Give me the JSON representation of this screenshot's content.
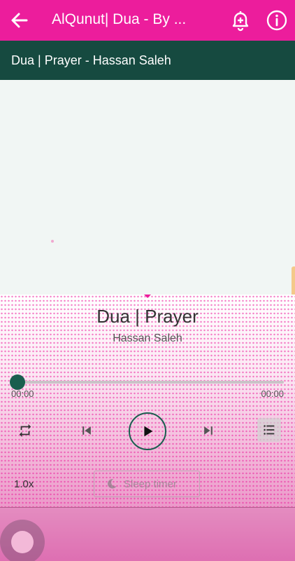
{
  "appbar": {
    "title": "AlQunut| Dua - By ...",
    "icons": [
      "back-arrow-icon",
      "add-alarm-bell-icon",
      "info-icon"
    ]
  },
  "subbar": {
    "title": "Dua | Prayer - Hassan Saleh"
  },
  "player": {
    "track_title": "Dua | Prayer",
    "artist": "Hassan Saleh",
    "current_time": "00:00",
    "duration": "00:00",
    "progress": 0,
    "speed": "1.0x",
    "sleep_timer_label": "Sleep timer",
    "icons": [
      "repeat-icon",
      "previous-icon",
      "play-icon",
      "next-icon",
      "queue-list-icon",
      "moon-icon"
    ]
  },
  "colors": {
    "appbar": "#ec1d9c",
    "subbar": "#164a40",
    "accent": "#1a5e4f",
    "background": "#f1f6f4"
  }
}
